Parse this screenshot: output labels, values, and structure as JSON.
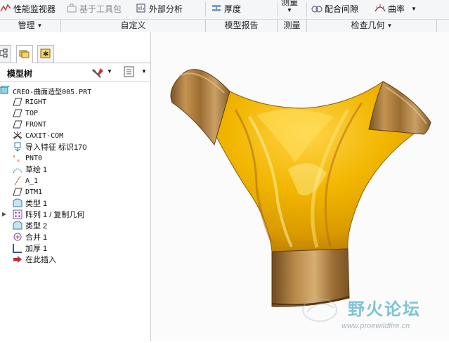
{
  "ribbon": {
    "buttons": [
      {
        "label": "性能监视器",
        "icon": "performance-monitor-icon"
      },
      {
        "label": "基于工具包",
        "icon": "toolkit-icon"
      },
      {
        "label": "外部分析",
        "icon": "external-analysis-icon"
      },
      {
        "label": "厚度",
        "icon": "thickness-icon"
      },
      {
        "label": "测量",
        "icon": "measure-icon"
      },
      {
        "label": "配合间隙",
        "icon": "mating-clearance-icon"
      },
      {
        "label": "曲率",
        "icon": "curvature-icon"
      }
    ],
    "groups": [
      {
        "label": "管理",
        "has_menu": true
      },
      {
        "label": "自定义",
        "has_menu": false
      },
      {
        "label": "模型报告",
        "has_menu": false
      },
      {
        "label": "测量",
        "has_menu": false
      },
      {
        "label": "检查几何",
        "has_menu": true
      }
    ]
  },
  "model_tree": {
    "title": "模型树",
    "items": [
      {
        "label": "CREO-曲面造型005.PRT",
        "icon": "part-icon"
      },
      {
        "label": "RIGHT",
        "icon": "datum-plane-icon"
      },
      {
        "label": "TOP",
        "icon": "datum-plane-icon"
      },
      {
        "label": "FRONT",
        "icon": "datum-plane-icon"
      },
      {
        "label": "CAXIT-COM",
        "icon": "coordinate-system-icon"
      },
      {
        "label": "导入特征 标识170",
        "icon": "import-feature-icon"
      },
      {
        "label": "PNT0",
        "icon": "datum-point-icon"
      },
      {
        "label": "草绘 1",
        "icon": "sketch-icon"
      },
      {
        "label": "A_1",
        "icon": "datum-axis-icon"
      },
      {
        "label": "DTM1",
        "icon": "datum-plane-icon"
      },
      {
        "label": "类型 1",
        "icon": "surface-icon"
      },
      {
        "label": "阵列 1 / 复制几何",
        "icon": "pattern-icon"
      },
      {
        "label": "类型 2",
        "icon": "surface-icon"
      },
      {
        "label": "合并 1",
        "icon": "merge-icon"
      },
      {
        "label": "加厚 1",
        "icon": "thicken-icon"
      },
      {
        "label": "在此插入",
        "icon": "insert-here-arrow-icon"
      }
    ]
  },
  "watermark": {
    "text": "野火论坛",
    "url": "www.proewildfire.cn"
  },
  "colors": {
    "accent_gold": "#f2b600",
    "wood_brown": "#a87a3c",
    "ribbon_bg": "#f5f6f8"
  }
}
